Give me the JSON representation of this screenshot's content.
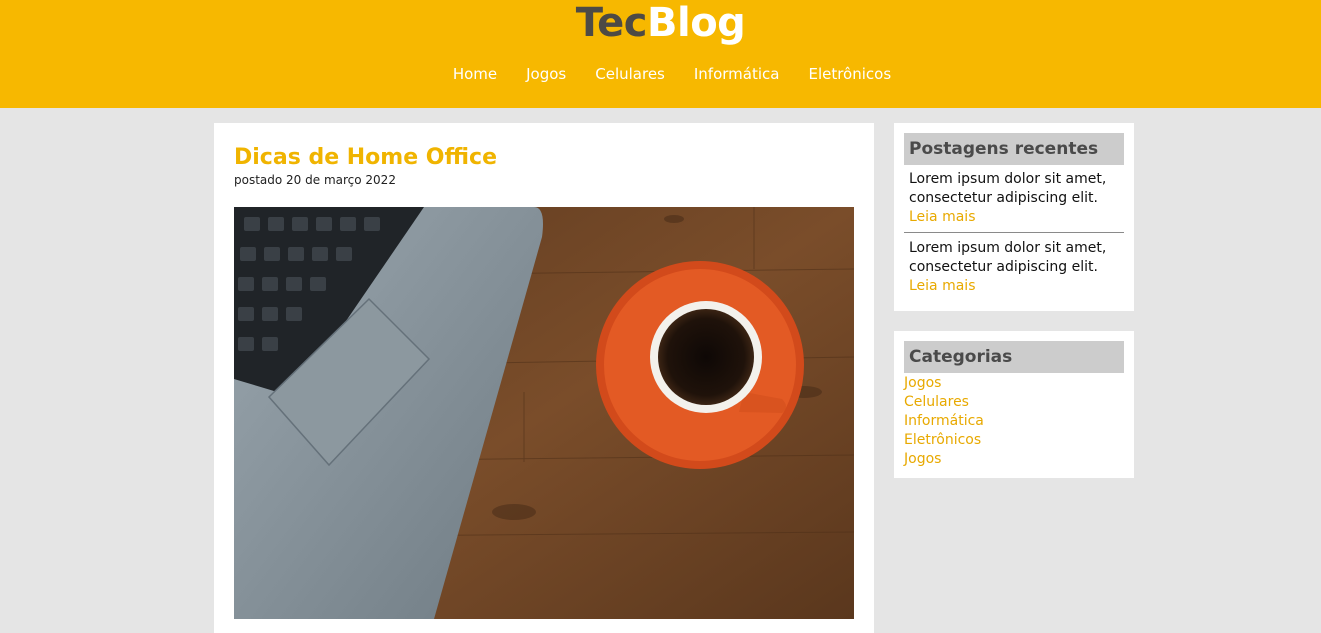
{
  "header": {
    "logo_part1": "Tec",
    "logo_part2": "Blog",
    "nav": [
      "Home",
      "Jogos",
      "Celulares",
      "Informática",
      "Eletrônicos"
    ]
  },
  "post": {
    "title": "Dicas de Home Office",
    "date": "postado 20 de março 2022"
  },
  "sidebar": {
    "recent": {
      "title": "Postagens recentes",
      "items": [
        {
          "text": "Lorem ipsum dolor sit amet, consectetur adipiscing elit.",
          "more": "Leia mais"
        },
        {
          "text": "Lorem ipsum dolor sit amet, consectetur adipiscing elit.",
          "more": "Leia mais"
        }
      ]
    },
    "categories": {
      "title": "Categorias",
      "items": [
        "Jogos",
        "Celulares",
        "Informática",
        "Eletrônicos",
        "Jogos"
      ]
    }
  },
  "colors": {
    "brand": "#f7b800",
    "link": "#e8a900",
    "logo_dark": "#4d4a45"
  }
}
